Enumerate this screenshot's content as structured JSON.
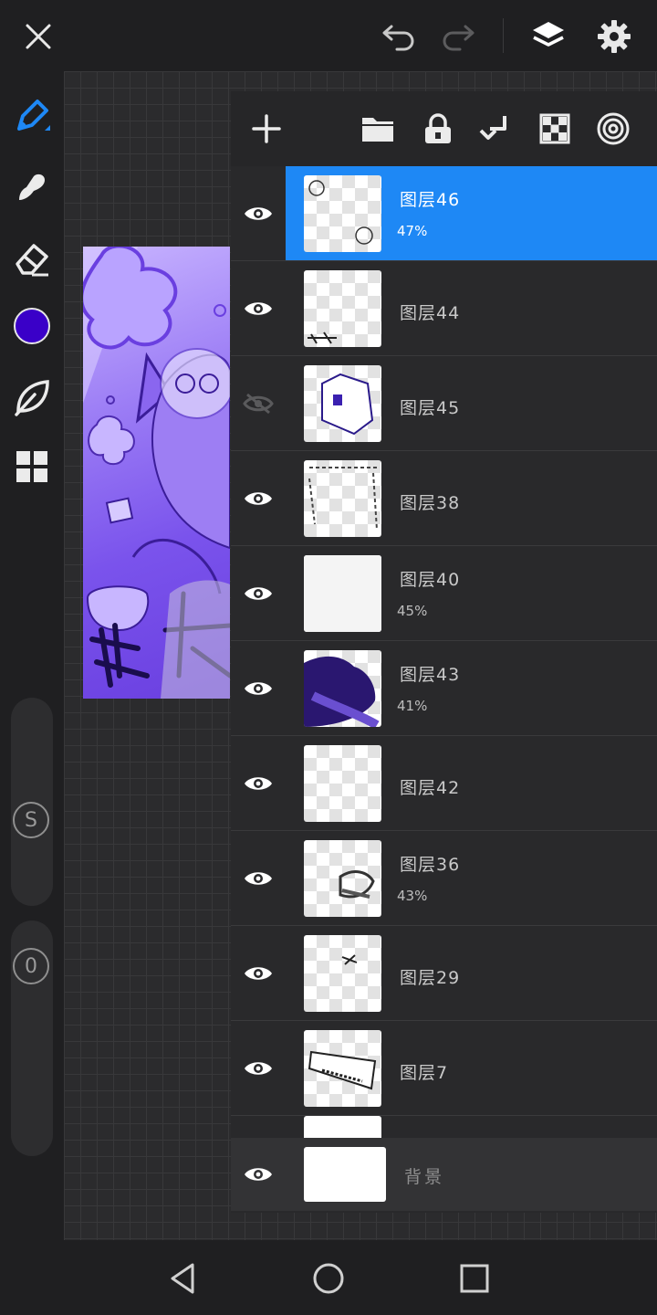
{
  "colors": {
    "accent": "#1e88f5",
    "current_color": "#3a00c8",
    "tool_active": "#1e88f5"
  },
  "topbar": {
    "icons": [
      "close-icon",
      "undo-icon",
      "redo-icon",
      "layers-icon",
      "settings-icon"
    ]
  },
  "left_toolbar": {
    "tools": [
      "brush-icon",
      "smudge-icon",
      "eraser-icon",
      "color-swatch",
      "leaf-icon",
      "grid-icon"
    ],
    "size_slider_label": "S",
    "opacity_slider_label": "0"
  },
  "layer_toolbar": {
    "icons": [
      "add-layer-icon",
      "folder-icon",
      "lock-icon",
      "merge-down-icon",
      "checker-icon",
      "target-icon"
    ]
  },
  "layers": [
    {
      "name": "图层46",
      "opacity": "47%",
      "visible": true,
      "selected": true
    },
    {
      "name": "图层44",
      "opacity": "",
      "visible": true,
      "selected": false
    },
    {
      "name": "图层45",
      "opacity": "",
      "visible": false,
      "selected": false
    },
    {
      "name": "图层38",
      "opacity": "",
      "visible": true,
      "selected": false
    },
    {
      "name": "图层40",
      "opacity": "45%",
      "visible": true,
      "selected": false
    },
    {
      "name": "图层43",
      "opacity": "41%",
      "visible": true,
      "selected": false
    },
    {
      "name": "图层42",
      "opacity": "",
      "visible": true,
      "selected": false
    },
    {
      "name": "图层36",
      "opacity": "43%",
      "visible": true,
      "selected": false
    },
    {
      "name": "图层29",
      "opacity": "",
      "visible": true,
      "selected": false
    },
    {
      "name": "图层7",
      "opacity": "",
      "visible": true,
      "selected": false
    }
  ],
  "background_layer": {
    "name": "背景",
    "visible": true
  },
  "navbar": {
    "icons": [
      "back-icon",
      "home-icon",
      "recents-icon"
    ]
  }
}
